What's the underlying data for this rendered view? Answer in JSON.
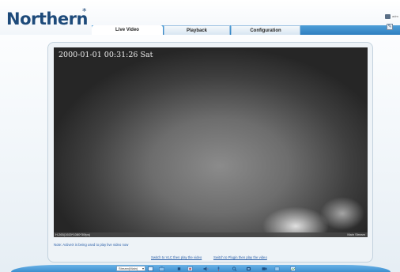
{
  "header": {
    "logo": "Northern",
    "logo_mark": "*",
    "user_text": "adm"
  },
  "tabs": [
    {
      "label": "Live Video",
      "active": true
    },
    {
      "label": "Playback",
      "active": false
    },
    {
      "label": "Configuration",
      "active": false
    }
  ],
  "video": {
    "timestamp": "2000-01-01 00:31:26 Sat",
    "info_left": "H.265(1920*1080*30fps)",
    "info_right": "Main Stream"
  },
  "note": "Note: ActiveX is being used to play live video now",
  "links": {
    "switch_vlc": "Switch to VLC then play the video",
    "switch_plugin": "Switch to Plugin then play the video"
  },
  "toolbar": {
    "stream_select_value": "Stream(Main)",
    "buttons": [
      "fullscreen-icon",
      "snapshot-icon",
      "stop-icon",
      "record-icon",
      "audio-icon",
      "microphone-icon",
      "zoom-icon",
      "ptz-icon",
      "camera-icon",
      "settings-icon",
      "image-icon"
    ]
  },
  "colors": {
    "brand_blue": "#1d4a7a",
    "nav_blue": "#2f7fc0",
    "link_blue": "#2b5fa8"
  }
}
